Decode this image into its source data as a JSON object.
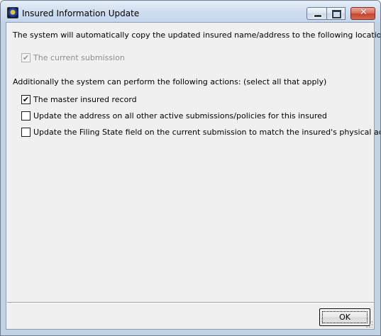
{
  "window": {
    "title": "Insured Information Update",
    "app_icon": "globe-app-icon",
    "controls": [
      "minimize-icon",
      "maximize-icon",
      "close-icon"
    ],
    "close_glyph": "✕"
  },
  "intro_text": "The system will automatically copy the updated insured name/address to the following locations:",
  "auto_copy": {
    "label": "The current submission",
    "checked": true,
    "enabled": false
  },
  "actions_heading": "Additionally the system can perform the following actions:  (select all that apply)",
  "actions": [
    {
      "label": "The master insured record",
      "checked": true,
      "mark": "✔"
    },
    {
      "label": "Update the address on all other active submissions/policies for this insured",
      "checked": false,
      "mark": ""
    },
    {
      "label": "Update the Filing State field on the current submission to match the insured's physical address",
      "checked": false,
      "mark": ""
    }
  ],
  "disabled_mark": "✔",
  "ok_button": "OK"
}
